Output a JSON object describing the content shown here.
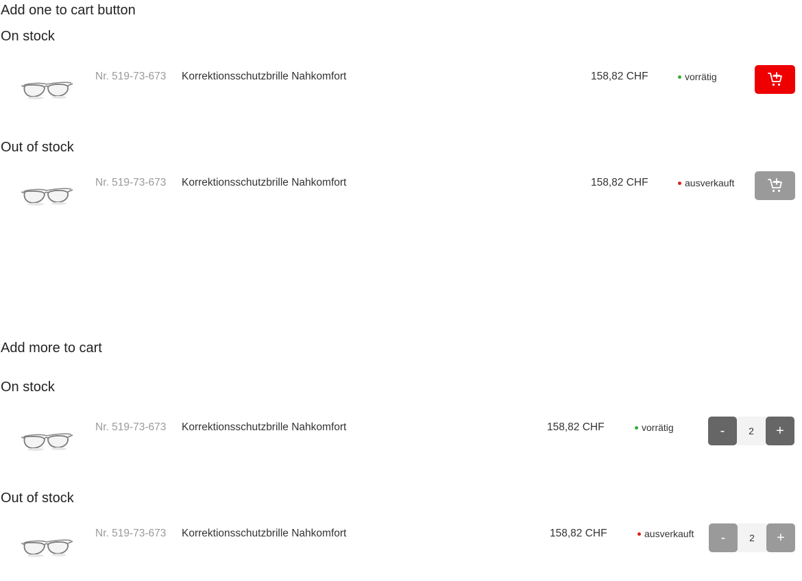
{
  "colors": {
    "accent_red": "#ee0000",
    "disabled_gray": "#9a9a9a",
    "stepper_dark": "#666666",
    "in_stock_dot": "#3aaa35",
    "out_stock_dot": "#e0201e"
  },
  "section_single": {
    "title": "Add one to cart button",
    "on_stock_heading": "On stock",
    "out_stock_heading": "Out of stock",
    "on_stock_row": {
      "image_icon": "safety-glasses",
      "article_no": "Nr. 519-73-673",
      "name": "Korrektionsschutzbrille Nahkomfort",
      "price": "158,82 CHF",
      "stock_label": "vorrätig",
      "button_icon": "add-to-cart-icon"
    },
    "out_stock_row": {
      "image_icon": "safety-glasses",
      "article_no": "Nr. 519-73-673",
      "name": "Korrektionsschutzbrille Nahkomfort",
      "price": "158,82 CHF",
      "stock_label": "ausverkauft",
      "button_icon": "add-to-cart-icon"
    }
  },
  "section_multi": {
    "title": "Add more to cart",
    "on_stock_heading": "On stock",
    "out_stock_heading": "Out of stock",
    "on_stock_row": {
      "image_icon": "safety-glasses",
      "article_no": "Nr. 519-73-673",
      "name": "Korrektionsschutzbrille Nahkomfort",
      "price": "158,82 CHF",
      "stock_label": "vorrätig",
      "minus_label": "-",
      "quantity": "2",
      "plus_label": "+"
    },
    "out_stock_row": {
      "image_icon": "safety-glasses",
      "article_no": "Nr. 519-73-673",
      "name": "Korrektionsschutzbrille Nahkomfort",
      "price": "158,82 CHF",
      "stock_label": "ausverkauft",
      "minus_label": "-",
      "quantity": "2",
      "plus_label": "+"
    }
  }
}
